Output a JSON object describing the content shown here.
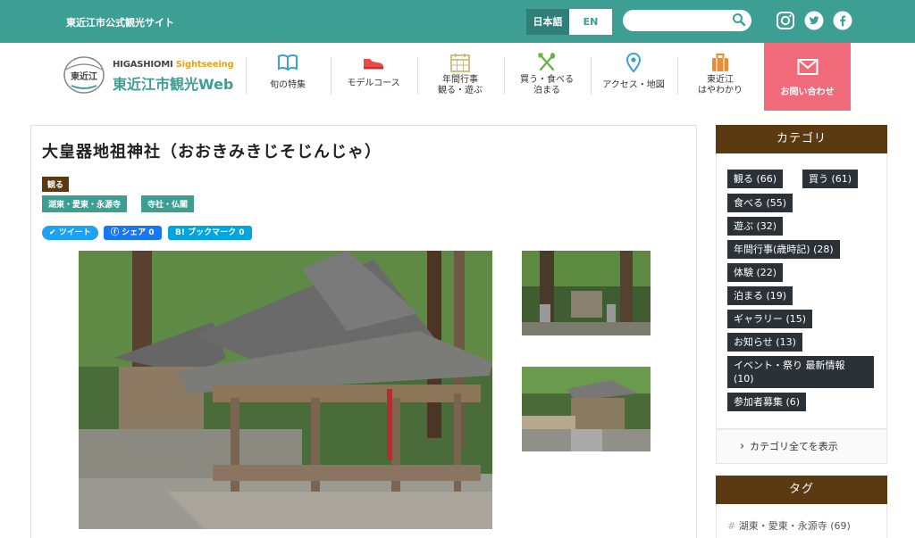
{
  "header": {
    "site_label": "東近江市公式観光サイト",
    "lang_ja": "日本語",
    "lang_en": "EN",
    "search_placeholder": ""
  },
  "logo": {
    "mark_text": "東近江",
    "en_1": "HIGASHIOMI",
    "en_2": " Sightseeing",
    "ja": "東近江市観光Web"
  },
  "nav": [
    {
      "label": "旬の特集",
      "icon": "book-icon"
    },
    {
      "label": "モデルコース",
      "icon": "shoe-icon"
    },
    {
      "label": "年間行事\n観る・遊ぶ",
      "icon": "calendar-icon"
    },
    {
      "label": "買う・食べる\n泊まる",
      "icon": "fork-spoon-icon"
    },
    {
      "label": "アクセス・地図",
      "icon": "map-pin-icon"
    },
    {
      "label": "東近江\nはやわかり",
      "icon": "suitcase-icon"
    }
  ],
  "contact_label": "お問い合わせ",
  "article": {
    "title": "大皇器地祖神社（おおきみきじそじんじゃ）",
    "category": "観る",
    "area_tags": [
      "湖東・愛東・永源寺",
      "寺社・仏閣"
    ],
    "share": {
      "tweet": "ツイート",
      "facebook": "シェア 0",
      "hatena": "B! ブックマーク  0"
    }
  },
  "sidebar": {
    "category_title": "カテゴリ",
    "categories": [
      "観る (66)",
      "買う (61)",
      "食べる (55)",
      "遊ぶ (32)",
      "年間行事(歳時記) (28)",
      "体験 (22)",
      "泊まる (19)",
      "ギャラリー (15)",
      "お知らせ (13)",
      "イベント・祭り 最新情報 (10)",
      "参加者募集 (6)"
    ],
    "show_all": "カテゴリ全てを表示",
    "tag_title": "タグ",
    "tags": [
      "湖東・愛東・永源寺 (69)"
    ]
  },
  "colors": {
    "teal": "#3d9f94",
    "brown": "#5b3a12",
    "pink": "#f06a7a",
    "chip": "#2a3238"
  }
}
